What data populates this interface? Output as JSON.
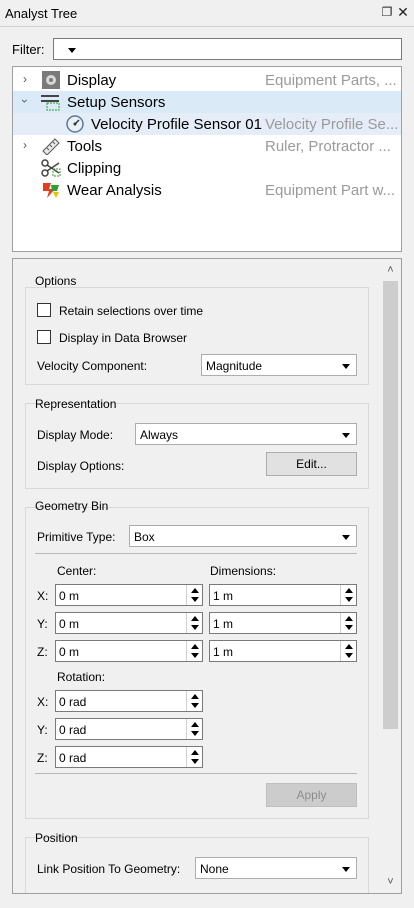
{
  "window": {
    "title": "Analyst Tree"
  },
  "filter": {
    "label": "Filter:",
    "value": ""
  },
  "tree": {
    "items": [
      {
        "label": "Display",
        "desc": "Equipment Parts, ...",
        "icon": "gear-icon"
      },
      {
        "label": "Setup Sensors",
        "desc": "",
        "icon": "sensor-list-icon"
      },
      {
        "label": "Velocity Profile Sensor 01",
        "desc": "Velocity Profile Se...",
        "icon": "gauge-icon"
      },
      {
        "label": "Tools",
        "desc": "Ruler, Protractor ...",
        "icon": "ruler-icon"
      },
      {
        "label": "Clipping",
        "desc": "",
        "icon": "scissors-icon"
      },
      {
        "label": "Wear Analysis",
        "desc": "Equipment Part w...",
        "icon": "wear-icon"
      }
    ]
  },
  "options": {
    "title": "Options",
    "retain_label": "Retain selections over time",
    "browser_label": "Display in Data Browser",
    "velocity_label": "Velocity Component:",
    "velocity_value": "Magnitude"
  },
  "representation": {
    "title": "Representation",
    "mode_label": "Display Mode:",
    "mode_value": "Always",
    "options_label": "Display Options:",
    "edit_label": "Edit..."
  },
  "geometry": {
    "title": "Geometry Bin",
    "primitive_label": "Primitive Type:",
    "primitive_value": "Box",
    "center_label": "Center:",
    "dimensions_label": "Dimensions:",
    "rotation_label": "Rotation:",
    "x": "X:",
    "y": "Y:",
    "z": "Z:",
    "center": [
      "0 m",
      "0 m",
      "0 m"
    ],
    "dimensions": [
      "1 m",
      "1 m",
      "1 m"
    ],
    "rotation": [
      "0 rad",
      "0 rad",
      "0 rad"
    ],
    "apply_label": "Apply"
  },
  "position": {
    "title": "Position",
    "link_label": "Link Position To Geometry:",
    "link_value": "None"
  },
  "colors": {
    "selected_row": "#dbeaf7",
    "desc_text": "#9a9a9a",
    "panel_bg": "#f0f0f0"
  }
}
